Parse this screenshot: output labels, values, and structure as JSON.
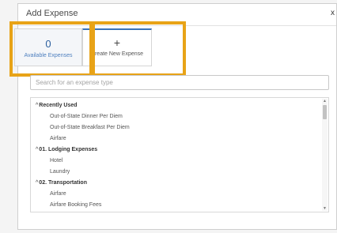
{
  "dialog": {
    "title": "Add Expense",
    "close_label": "x"
  },
  "tiles": {
    "available": {
      "count": "0",
      "label": "Available Expenses"
    },
    "create": {
      "icon": "+",
      "label": "Create New Expense"
    }
  },
  "search": {
    "placeholder": "Search for an expense type",
    "value": ""
  },
  "list": {
    "groups": [
      {
        "label": "Recently Used",
        "caret": "^",
        "items": [
          "Out-of-State Dinner Per Diem",
          "Out-of-State Breakfast Per Diem",
          "Airfare"
        ]
      },
      {
        "label": "01. Lodging Expenses",
        "caret": "^",
        "items": [
          "Hotel",
          "Laundry"
        ]
      },
      {
        "label": "02. Transportation",
        "caret": "^",
        "items": [
          "Airfare",
          "Airfare Booking Fees"
        ]
      }
    ]
  },
  "scrollbar": {
    "up_glyph": "▲",
    "down_glyph": "▼"
  },
  "colors": {
    "highlight": "#e8a317",
    "accent": "#3b73b9"
  }
}
